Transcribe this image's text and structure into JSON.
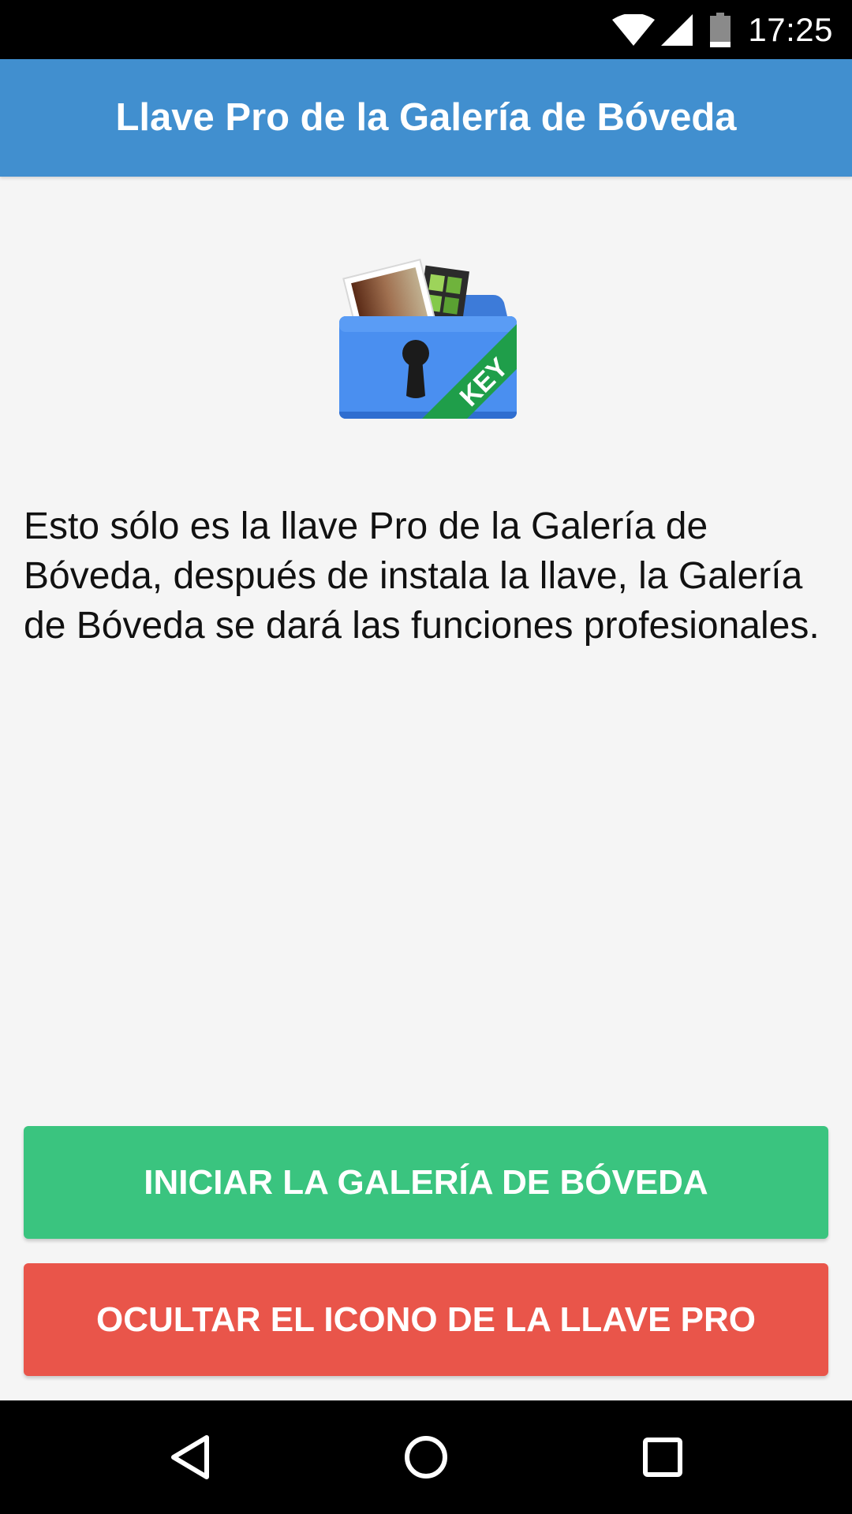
{
  "status_bar": {
    "time": "17:25",
    "icons": [
      "wifi-icon",
      "cell-signal-icon",
      "battery-icon"
    ]
  },
  "app_bar": {
    "title": "Llave Pro de la Galería de Bóveda"
  },
  "logo": {
    "icon": "vault-folder-key-icon",
    "badge_text": "KEY"
  },
  "main": {
    "description": "Esto sólo es la llave Pro de la Galería de Bóveda, después de instala la llave, la Galería de Bóveda se dará las funciones profesionales."
  },
  "buttons": {
    "start_label": "INICIAR LA GALERÍA DE BÓVEDA",
    "hide_label": "OCULTAR EL ICONO DE LA LLAVE PRO"
  },
  "nav_bar": {
    "icons": [
      "back-icon",
      "home-icon",
      "recents-icon"
    ]
  },
  "colors": {
    "app_bar": "#418fcf",
    "start_button": "#3ac47f",
    "hide_button": "#e9554a",
    "background": "#f5f5f5"
  }
}
